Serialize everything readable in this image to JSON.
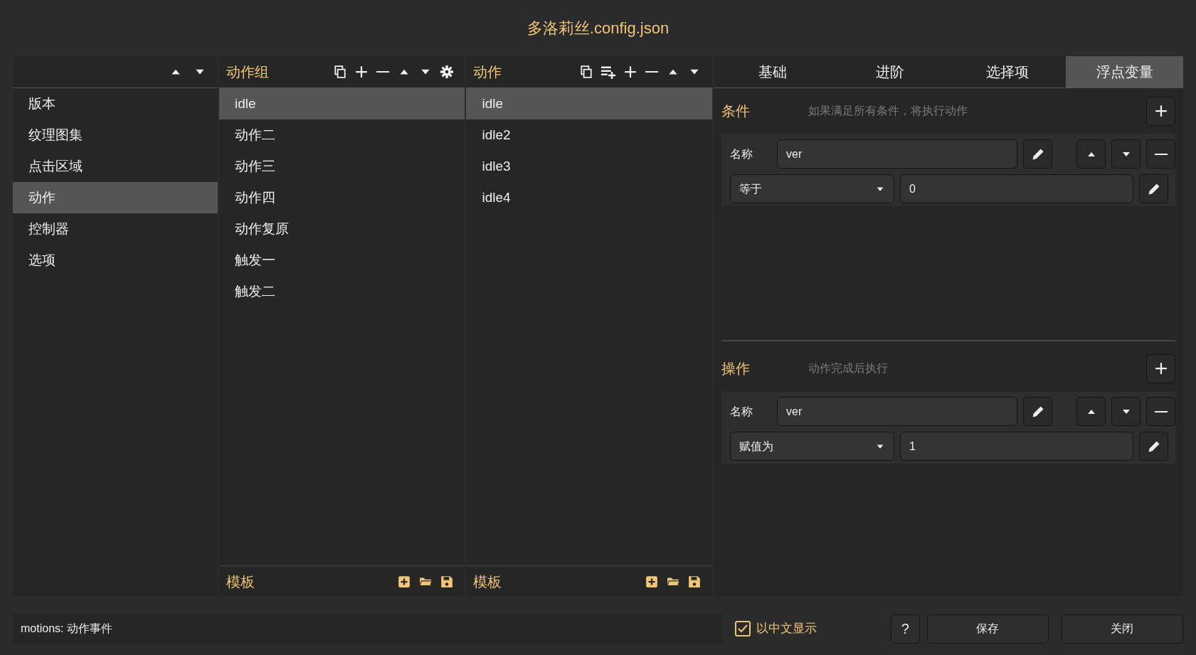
{
  "window": {
    "title": "多洛莉丝.config.json"
  },
  "sidebar": {
    "items": [
      {
        "label": "版本",
        "selected": false
      },
      {
        "label": "纹理图集",
        "selected": false
      },
      {
        "label": "点击区域",
        "selected": false
      },
      {
        "label": "动作",
        "selected": true
      },
      {
        "label": "控制器",
        "selected": false
      },
      {
        "label": "选项",
        "selected": false
      }
    ]
  },
  "groups": {
    "title": "动作组",
    "items": [
      {
        "label": "idle",
        "selected": true
      },
      {
        "label": "动作二",
        "selected": false
      },
      {
        "label": "动作三",
        "selected": false
      },
      {
        "label": "动作四",
        "selected": false
      },
      {
        "label": "动作复原",
        "selected": false
      },
      {
        "label": "触发一",
        "selected": false
      },
      {
        "label": "触发二",
        "selected": false
      }
    ],
    "template_label": "模板"
  },
  "motions": {
    "title": "动作",
    "items": [
      {
        "label": "idle",
        "selected": true
      },
      {
        "label": "idle2",
        "selected": false
      },
      {
        "label": "idle3",
        "selected": false
      },
      {
        "label": "idle4",
        "selected": false
      }
    ],
    "template_label": "模板"
  },
  "tabs": [
    {
      "label": "基础",
      "selected": false
    },
    {
      "label": "进阶",
      "selected": false
    },
    {
      "label": "选择项",
      "selected": false
    },
    {
      "label": "浮点变量",
      "selected": true
    }
  ],
  "sections": [
    {
      "title": "条件",
      "hint": "如果满足所有条件，将执行动作",
      "rows": [
        {
          "name_label": "名称",
          "name_value": "ver",
          "operator": "等于",
          "value": "0"
        }
      ]
    },
    {
      "title": "操作",
      "hint": "动作完成后执行",
      "rows": [
        {
          "name_label": "名称",
          "name_value": "ver",
          "operator": "赋值为",
          "value": "1"
        }
      ]
    }
  ],
  "status_bar": {
    "text": "motions: 动作事件"
  },
  "show_chinese": {
    "label": "以中文显示",
    "checked": true
  },
  "buttons": {
    "help": "?",
    "save": "保存",
    "close": "关闭"
  }
}
